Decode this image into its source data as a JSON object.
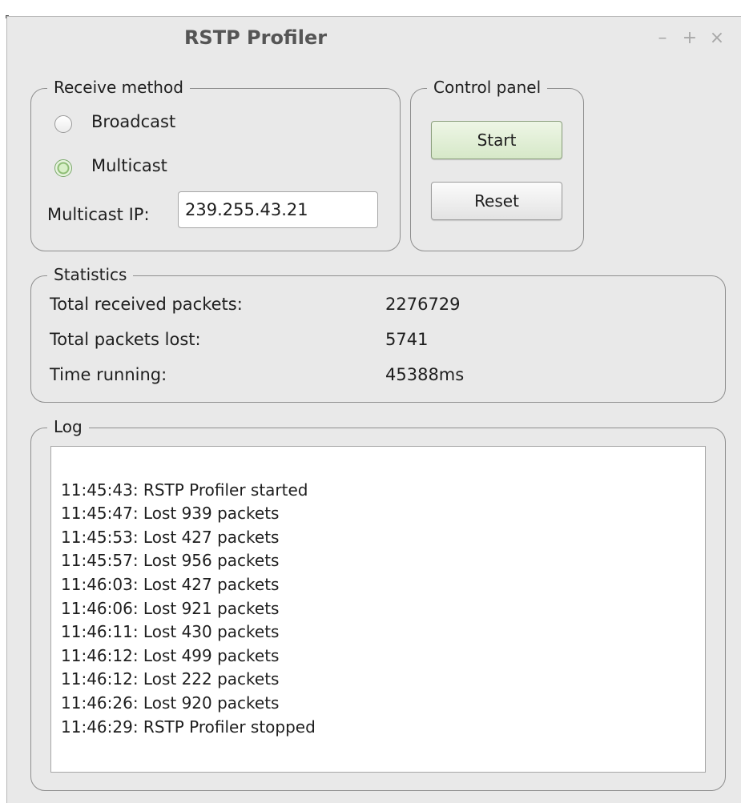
{
  "window": {
    "title": "RSTP Profiler",
    "controls": {
      "minimize": "–",
      "maximize": "+",
      "close": "×"
    }
  },
  "receive_method": {
    "title": "Receive method",
    "options": [
      {
        "label": "Broadcast",
        "checked": false
      },
      {
        "label": "Multicast",
        "checked": true
      }
    ],
    "multicast_ip_label": "Multicast IP:",
    "multicast_ip_value": "239.255.43.21"
  },
  "control_panel": {
    "title": "Control panel",
    "start_label": "Start",
    "reset_label": "Reset"
  },
  "statistics": {
    "title": "Statistics",
    "rows": [
      {
        "label": "Total received packets:",
        "value": "2276729"
      },
      {
        "label": "Total packets lost:",
        "value": "5741"
      },
      {
        "label": "Time running:",
        "value": "45388ms"
      }
    ]
  },
  "log": {
    "title": "Log",
    "lines": [
      "",
      "11:45:43: RSTP Profiler started",
      "11:45:47: Lost 939 packets",
      "11:45:53: Lost 427 packets",
      "11:45:57: Lost 956 packets",
      "11:46:03: Lost 427 packets",
      "11:46:06: Lost 921 packets",
      "11:46:11: Lost 430 packets",
      "11:46:12: Lost 499 packets",
      "11:46:12: Lost 222 packets",
      "11:46:26: Lost 920 packets",
      "11:46:29: RSTP Profiler stopped"
    ]
  }
}
